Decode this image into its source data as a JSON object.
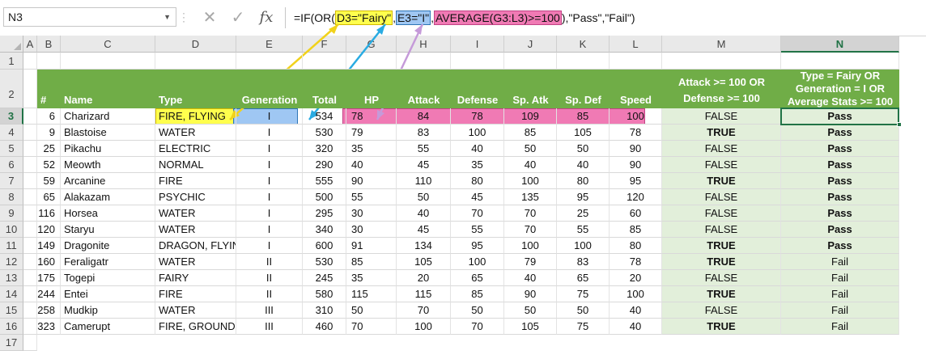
{
  "name_box": "N3",
  "formula": {
    "prefix": "=IF(OR(",
    "arg1": "D3=\"Fairy\"",
    "comma1": ",",
    "arg2": "E3=\"I\"",
    "comma2": ",",
    "arg3": "AVERAGE(G3:L3)>=100",
    "suffix": "),\"Pass\",\"Fail\")"
  },
  "icons": {
    "cancel": "✕",
    "enter": "✓",
    "fx": "fx"
  },
  "columns": [
    "A",
    "B",
    "C",
    "D",
    "E",
    "F",
    "G",
    "H",
    "I",
    "J",
    "K",
    "L",
    "M",
    "N"
  ],
  "rows": [
    "1",
    "2",
    "3",
    "4",
    "5",
    "6",
    "7",
    "8",
    "9",
    "10",
    "11",
    "12",
    "13",
    "14",
    "15",
    "16",
    "17"
  ],
  "headers": {
    "num": "#",
    "name": "Name",
    "type": "Type",
    "generation": "Generation",
    "total": "Total",
    "hp": "HP",
    "attack": "Attack",
    "defense": "Defense",
    "spatk": "Sp. Atk",
    "spdef": "Sp. Def",
    "speed": "Speed",
    "m_line1": "Attack >= 100 OR",
    "m_line2": "Defense >= 100",
    "n_line1": "Type = Fairy OR",
    "n_line2": "Generation = I OR",
    "n_line3": "Average Stats >= 100"
  },
  "table": [
    [
      "6",
      "Charizard",
      "FIRE, FLYING",
      "I",
      "534",
      "78",
      "84",
      "78",
      "109",
      "85",
      "100",
      "FALSE",
      "Pass"
    ],
    [
      "9",
      "Blastoise",
      "WATER",
      "I",
      "530",
      "79",
      "83",
      "100",
      "85",
      "105",
      "78",
      "TRUE",
      "Pass"
    ],
    [
      "25",
      "Pikachu",
      "ELECTRIC",
      "I",
      "320",
      "35",
      "55",
      "40",
      "50",
      "50",
      "90",
      "FALSE",
      "Pass"
    ],
    [
      "52",
      "Meowth",
      "NORMAL",
      "I",
      "290",
      "40",
      "45",
      "35",
      "40",
      "40",
      "90",
      "FALSE",
      "Pass"
    ],
    [
      "59",
      "Arcanine",
      "FIRE",
      "I",
      "555",
      "90",
      "110",
      "80",
      "100",
      "80",
      "95",
      "TRUE",
      "Pass"
    ],
    [
      "65",
      "Alakazam",
      "PSYCHIC",
      "I",
      "500",
      "55",
      "50",
      "45",
      "135",
      "95",
      "120",
      "FALSE",
      "Pass"
    ],
    [
      "116",
      "Horsea",
      "WATER",
      "I",
      "295",
      "30",
      "40",
      "70",
      "70",
      "25",
      "60",
      "FALSE",
      "Pass"
    ],
    [
      "120",
      "Staryu",
      "WATER",
      "I",
      "340",
      "30",
      "45",
      "55",
      "70",
      "55",
      "85",
      "FALSE",
      "Pass"
    ],
    [
      "149",
      "Dragonite",
      "DRAGON, FLYING",
      "I",
      "600",
      "91",
      "134",
      "95",
      "100",
      "100",
      "80",
      "TRUE",
      "Pass"
    ],
    [
      "160",
      "Feraligatr",
      "WATER",
      "II",
      "530",
      "85",
      "105",
      "100",
      "79",
      "83",
      "78",
      "TRUE",
      "Fail"
    ],
    [
      "175",
      "Togepi",
      "FAIRY",
      "II",
      "245",
      "35",
      "20",
      "65",
      "40",
      "65",
      "20",
      "FALSE",
      "Fail"
    ],
    [
      "244",
      "Entei",
      "FIRE",
      "II",
      "580",
      "115",
      "115",
      "85",
      "90",
      "75",
      "100",
      "TRUE",
      "Fail"
    ],
    [
      "258",
      "Mudkip",
      "WATER",
      "III",
      "310",
      "50",
      "70",
      "50",
      "50",
      "50",
      "40",
      "FALSE",
      "Fail"
    ],
    [
      "323",
      "Camerupt",
      "FIRE, GROUND",
      "III",
      "460",
      "70",
      "100",
      "70",
      "105",
      "75",
      "40",
      "TRUE",
      "Fail"
    ]
  ],
  "colors": {
    "header_green": "#70ad47",
    "result_fill": "#e2efda",
    "yellow": "#ffff4d",
    "blue": "#9fc7f3",
    "pink": "#f07ab4",
    "selection": "#217346"
  }
}
